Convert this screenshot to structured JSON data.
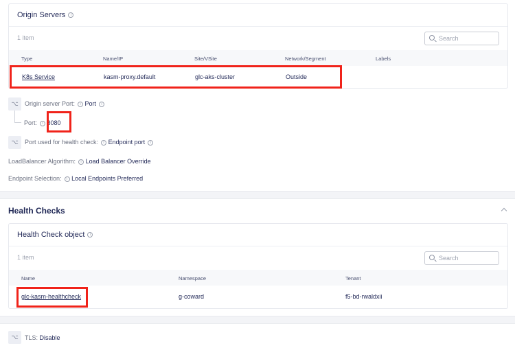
{
  "origin_servers": {
    "title": "Origin Servers",
    "count": "1 item",
    "search_placeholder": "Search",
    "columns": [
      "Type",
      "Name/IP",
      "Site/VSite",
      "Network/Segment",
      "Labels"
    ],
    "rows": [
      {
        "type": "K8s Service",
        "name": "kasm-proxy.default",
        "site": "glc-aks-cluster",
        "network": "Outside",
        "labels": ""
      }
    ]
  },
  "properties": {
    "origin_port_label": "Origin server Port:",
    "origin_port_value": "Port",
    "port_label": "Port:",
    "port_value": "8080",
    "health_port_label": "Port used for health check:",
    "health_port_value": "Endpoint port",
    "lb_label": "LoadBalancer Algorithm:",
    "lb_value": "Load Balancer Override",
    "endpoint_label": "Endpoint Selection:",
    "endpoint_value": "Local Endpoints Preferred"
  },
  "health_checks": {
    "title": "Health Checks",
    "card_title": "Health Check object",
    "count": "1 item",
    "search_placeholder": "Search",
    "columns": [
      "Name",
      "Namespace",
      "Tenant"
    ],
    "rows": [
      {
        "name": "glc-kasm-healthcheck",
        "namespace": "g-coward",
        "tenant": "f5-bd-rwaldxii"
      }
    ]
  },
  "tls": {
    "label": "TLS:",
    "value": "Disable"
  }
}
